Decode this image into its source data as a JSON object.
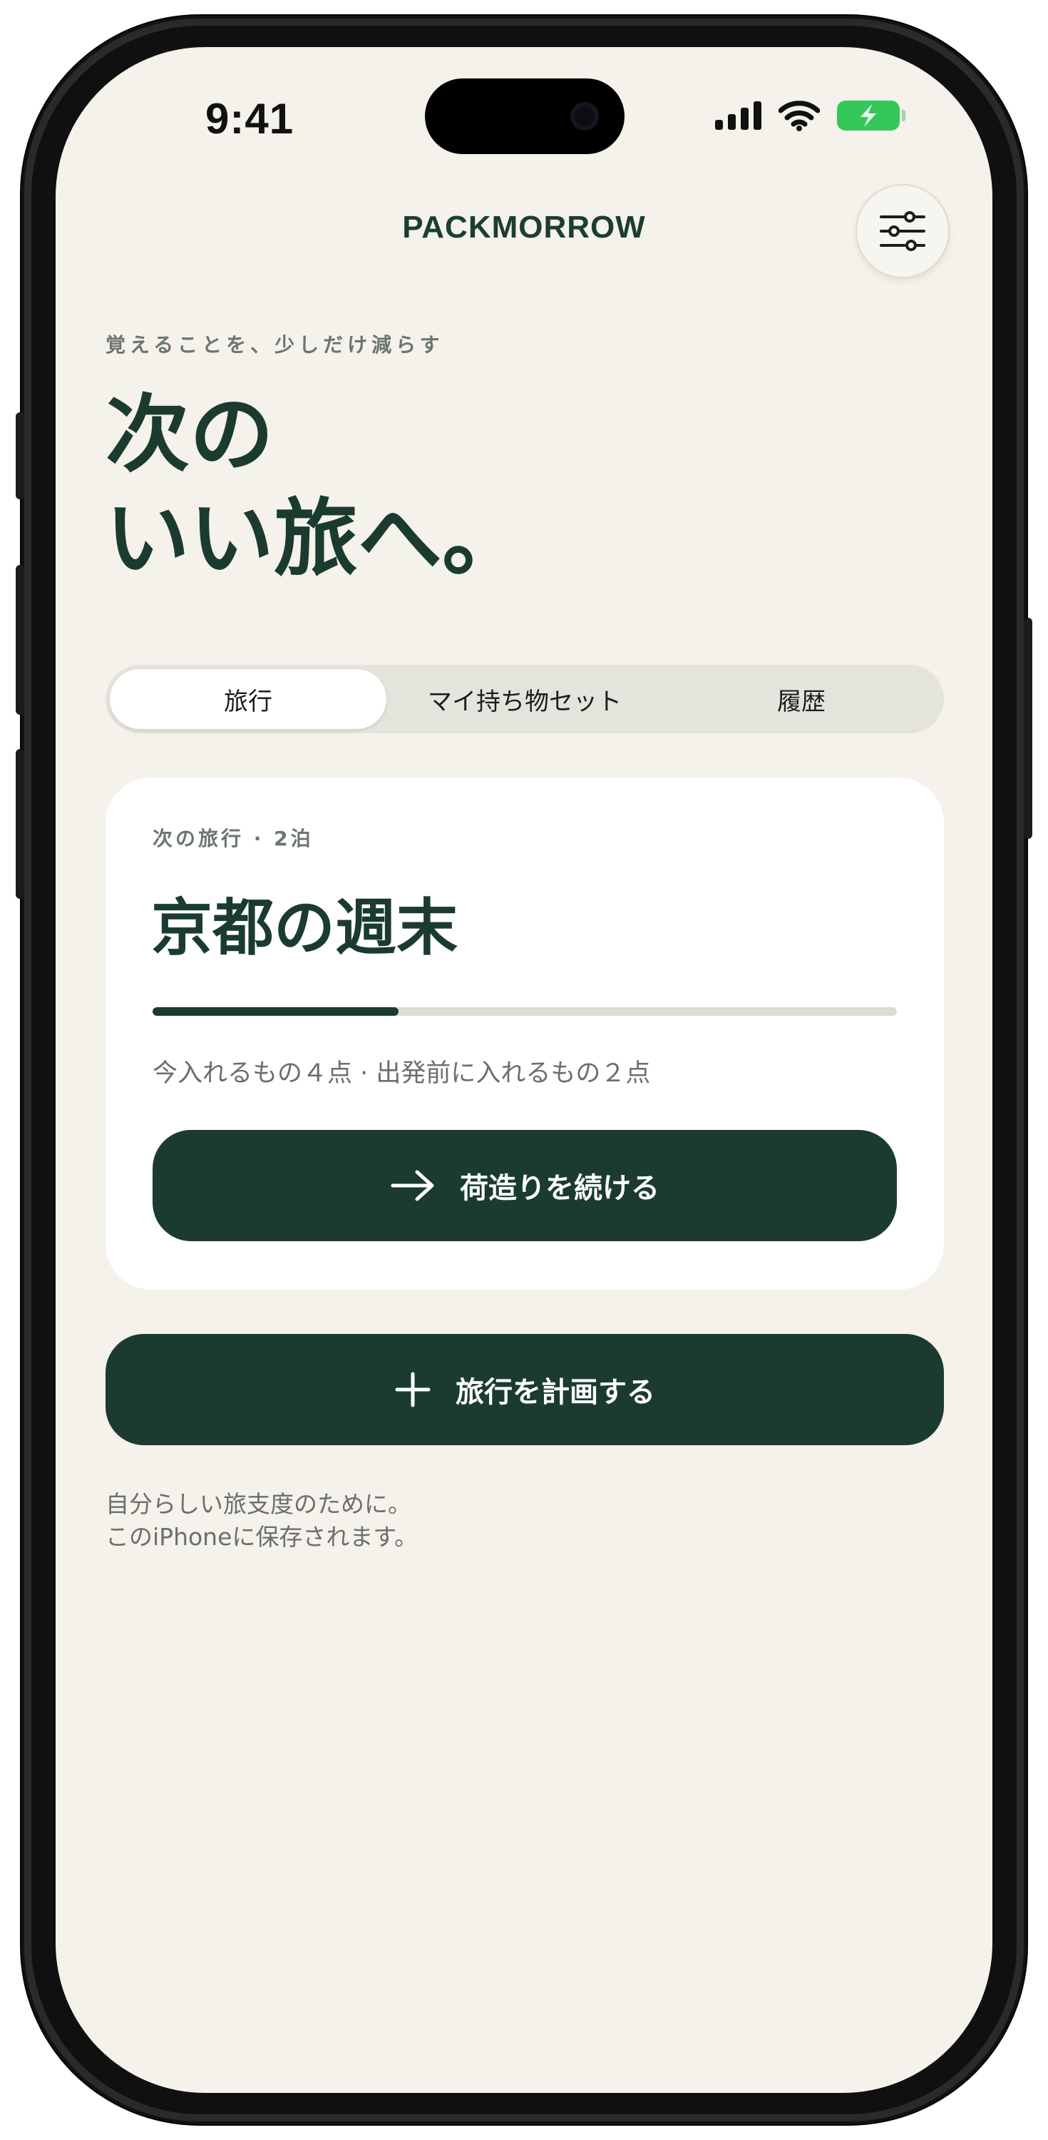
{
  "status_bar": {
    "time": "9:41"
  },
  "header": {
    "brand": "PACKMORROW",
    "filter_icon": "sliders-icon"
  },
  "tagline": "覚えることを、少しだけ減らす",
  "hero": {
    "line1": "次の",
    "line2": "いい旅へ。"
  },
  "tabs": [
    {
      "label": "旅行",
      "active": true
    },
    {
      "label": "マイ持ち物セット",
      "active": false
    },
    {
      "label": "履歴",
      "active": false
    }
  ],
  "trip_card": {
    "meta": "次の旅行 · 2泊",
    "title": "京都の週末",
    "progress": 0.33,
    "summary": "今入れるもの４点 · 出発前に入れるもの２点",
    "continue_label": "荷造りを続ける",
    "continue_icon": "arrow-right-icon"
  },
  "plan_button": {
    "label": "旅行を計画する",
    "icon": "plus-icon"
  },
  "footnote": {
    "line1": "自分らしい旅支度のために。",
    "line2": "このiPhoneに保存されます。"
  },
  "colors": {
    "background": "#f4f2ea",
    "accent": "#1b3b30",
    "card": "#ffffff",
    "segment_track": "#e5e4dc",
    "muted_text": "#6b6f6b",
    "battery": "#35c759"
  }
}
